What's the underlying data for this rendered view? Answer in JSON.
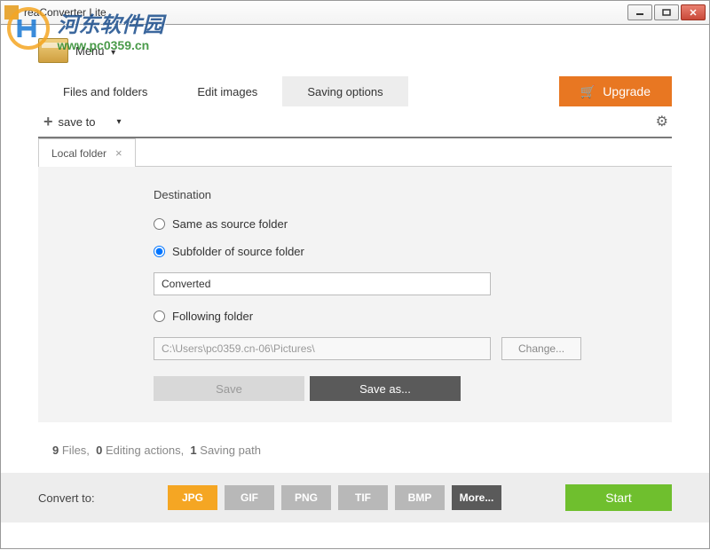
{
  "watermark": {
    "cn": "河东软件园",
    "url": "www.pc0359.cn"
  },
  "titlebar": {
    "title": "reaConverter Lite"
  },
  "menu": {
    "label": "Menu"
  },
  "main_tabs": {
    "files": "Files and folders",
    "edit": "Edit images",
    "saving": "Saving options"
  },
  "upgrade": {
    "label": "Upgrade"
  },
  "toolbar": {
    "save_to": "save to"
  },
  "subtab": {
    "label": "Local folder"
  },
  "panel": {
    "destination_title": "Destination",
    "radio_same": "Same as source folder",
    "radio_subfolder": "Subfolder of source folder",
    "subfolder_value": "Converted",
    "radio_following": "Following folder",
    "following_value": "C:\\Users\\pc0359.cn-06\\Pictures\\",
    "change_label": "Change...",
    "save_label": "Save",
    "saveas_label": "Save as..."
  },
  "status": {
    "files_count": "9",
    "files_label": "Files,",
    "edit_count": "0",
    "edit_label": "Editing actions,",
    "saving_count": "1",
    "saving_label": "Saving path"
  },
  "footer": {
    "convert_label": "Convert to:",
    "fmt_jpg": "JPG",
    "fmt_gif": "GIF",
    "fmt_png": "PNG",
    "fmt_tif": "TIF",
    "fmt_bmp": "BMP",
    "fmt_more": "More...",
    "start": "Start"
  }
}
